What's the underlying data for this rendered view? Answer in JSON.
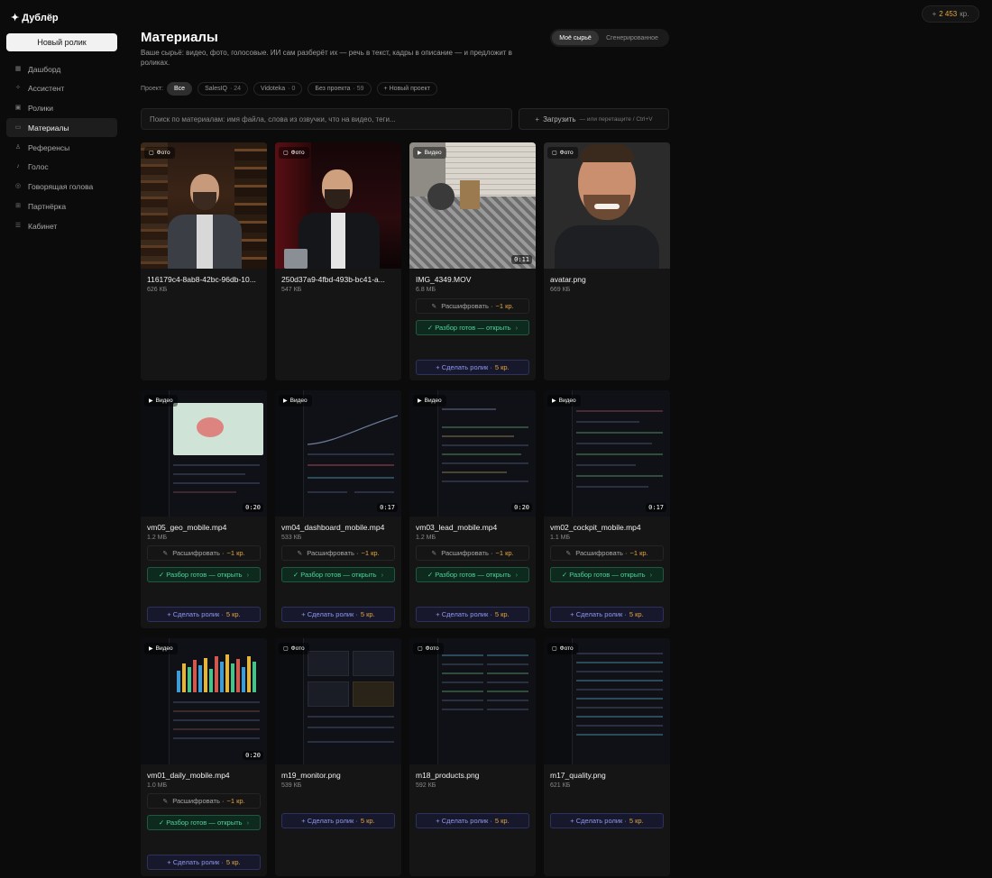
{
  "app": {
    "name": "Дублёр"
  },
  "sidebar": {
    "new_button": "Новый ролик",
    "items": [
      {
        "label": "Дашборд",
        "icon": "dashboard-icon"
      },
      {
        "label": "Ассистент",
        "icon": "assistant-icon"
      },
      {
        "label": "Ролики",
        "icon": "videos-icon"
      },
      {
        "label": "Материалы",
        "icon": "folder-icon",
        "active": true
      },
      {
        "label": "Референсы",
        "icon": "references-icon"
      },
      {
        "label": "Голос",
        "icon": "microphone-icon"
      },
      {
        "label": "Говорящая голова",
        "icon": "talking-head-icon"
      },
      {
        "label": "Партнёрка",
        "icon": "gift-icon"
      },
      {
        "label": "Кабинет",
        "icon": "account-icon"
      }
    ]
  },
  "credits": {
    "plus": "+",
    "amount": "2 453",
    "unit": "кр."
  },
  "header": {
    "title": "Материалы",
    "subtitle": "Ваше сырьё: видео, фото, голосовые. ИИ сам разберёт их — речь в текст, кадры в описание — и предложит в роликах.",
    "tabs": [
      "Моё сырьё",
      "Сгенерированное"
    ],
    "active_tab": "Моё сырьё"
  },
  "projects": {
    "label": "Проект:",
    "chips": [
      {
        "name": "Все",
        "count": ""
      },
      {
        "name": "SalesIQ",
        "count": "· 24"
      },
      {
        "name": "Vidoteka",
        "count": "· 0"
      },
      {
        "name": "Без проекта",
        "count": "· 59"
      }
    ],
    "new_project": "+ Новый проект"
  },
  "search": {
    "placeholder": "Поиск по материалам: имя файла, слова из озвучки, что на видео, теги..."
  },
  "upload": {
    "label": "Загрузить",
    "hint": "— или перетащите / Ctrl+V"
  },
  "actions": {
    "transcribe": "Расшифровать ·",
    "transcribe_cost": "~1 кр.",
    "ready": "✓ Разбор готов — открыть",
    "ready_chevron": "›",
    "make": "+ Сделать ролик ·",
    "make_cost": "5 кр."
  },
  "cards": [
    {
      "type": "Фото",
      "name": "116179c4-8ab8-42bc-96db-10...",
      "size": "626 КБ"
    },
    {
      "type": "Фото",
      "name": "250d37a9-4fbd-493b-bc41-a...",
      "size": "547 КБ"
    },
    {
      "type": "Видео",
      "name": "IMG_4349.MOV",
      "size": "6.8 МБ",
      "duration": "0:11"
    },
    {
      "type": "Фото",
      "name": "avatar.png",
      "size": "669 КБ"
    },
    {
      "type": "Видео",
      "name": "vm05_geo_mobile.mp4",
      "size": "1.2 МБ",
      "duration": "0:20"
    },
    {
      "type": "Видео",
      "name": "vm04_dashboard_mobile.mp4",
      "size": "533 КБ",
      "duration": "0:17"
    },
    {
      "type": "Видео",
      "name": "vm03_lead_mobile.mp4",
      "size": "1.2 МБ",
      "duration": "0:20"
    },
    {
      "type": "Видео",
      "name": "vm02_cockpit_mobile.mp4",
      "size": "1.1 МБ",
      "duration": "0:17"
    },
    {
      "type": "Видео",
      "name": "vm01_daily_mobile.mp4",
      "size": "1.0 МБ",
      "duration": "0:20"
    },
    {
      "type": "Фото",
      "name": "m19_monitor.png",
      "size": "539 КБ"
    },
    {
      "type": "Фото",
      "name": "m18_products.png",
      "size": "592 КБ"
    },
    {
      "type": "Фото",
      "name": "m17_quality.png",
      "size": "621 КБ"
    }
  ],
  "colors": {
    "accent_amber": "#e3a644",
    "ready_green": "#4fd49a",
    "make_indigo": "#8f97f3"
  }
}
